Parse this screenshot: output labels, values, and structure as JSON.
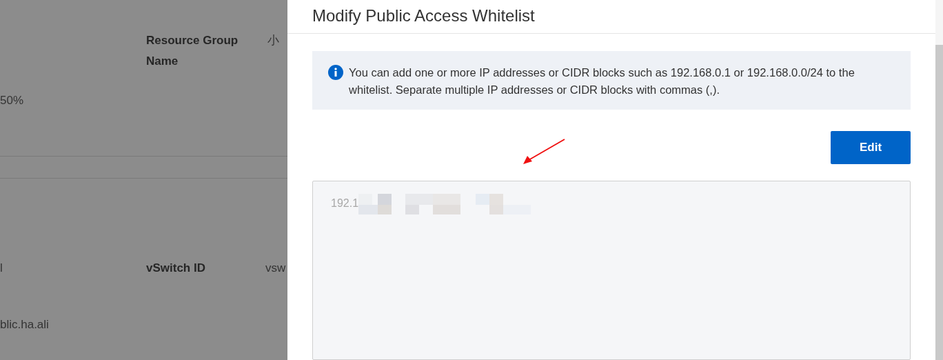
{
  "background_table": {
    "rows": [
      {
        "cells": [
          {
            "text": ""
          },
          {
            "text": "Resource Group Name",
            "kind": "label"
          },
          {
            "text": "小",
            "kind": "value"
          }
        ]
      },
      {
        "cells": [
          {
            "text": "50%",
            "kind": "value"
          }
        ]
      },
      {
        "cells": [
          {
            "text": "l",
            "kind": "value"
          },
          {
            "text": "vSwitch ID",
            "kind": "label"
          },
          {
            "text": "vsw",
            "kind": "value"
          }
        ]
      },
      {
        "cells": [
          {
            "text": "blic.ha.ali",
            "kind": "value"
          }
        ]
      }
    ]
  },
  "dialog": {
    "title": "Modify Public Access Whitelist",
    "notice": "You can add one or more IP addresses or CIDR blocks such as 192.168.0.1 or 192.168.0.0/24 to the whitelist. Separate multiple IP addresses or CIDR blocks with commas (,).",
    "edit_button": "Edit",
    "whitelist": {
      "value": "192.1"
    }
  }
}
